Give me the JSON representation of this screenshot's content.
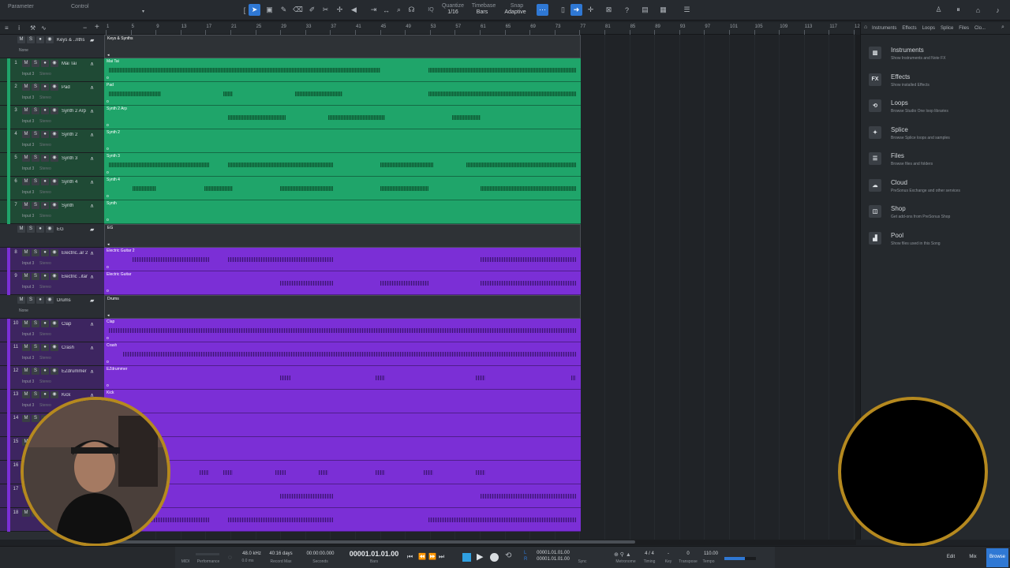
{
  "toolbar": {
    "parameter": "Parameter",
    "control": "Control",
    "quantize_label": "Quantize",
    "quantize_value": "1/16",
    "timebase_label": "Timebase",
    "timebase_value": "Bars",
    "snap_label": "Snap",
    "snap_value": "Adaptive",
    "iq": "IQ"
  },
  "ruler": {
    "ticks": [
      "1",
      "5",
      "9",
      "13",
      "17",
      "21",
      "25",
      "29",
      "33",
      "37",
      "41",
      "45",
      "49",
      "53",
      "57",
      "61",
      "65",
      "69",
      "73",
      "77",
      "81",
      "85",
      "89",
      "93",
      "97",
      "101",
      "105",
      "109",
      "113",
      "117",
      "121"
    ]
  },
  "tracks": [
    {
      "type": "folder",
      "name": "Keys & ..nths",
      "clip": "Keys & Synths",
      "input": "None"
    },
    {
      "num": "1",
      "name": "Mai Tai",
      "clip": "Mai Tai",
      "input": "Input 3",
      "mode": "Stereo",
      "color": "green"
    },
    {
      "num": "2",
      "name": "Pad",
      "clip": "Pad",
      "input": "Input 3",
      "mode": "Stereo",
      "color": "green"
    },
    {
      "num": "3",
      "name": "Synth 2 Arp",
      "clip": "Synth 2 Arp",
      "input": "Input 3",
      "mode": "Stereo",
      "color": "green"
    },
    {
      "num": "4",
      "name": "Synth 2",
      "clip": "Synth 2",
      "input": "Input 3",
      "mode": "Stereo",
      "color": "green"
    },
    {
      "num": "5",
      "name": "Synth 3",
      "clip": "Synth 3",
      "input": "Input 3",
      "mode": "Stereo",
      "color": "green"
    },
    {
      "num": "6",
      "name": "Synth 4",
      "clip": "Synth 4",
      "input": "Input 3",
      "mode": "Stereo",
      "color": "green"
    },
    {
      "num": "7",
      "name": "Synth",
      "clip": "Synth",
      "input": "Input 3",
      "mode": "Stereo",
      "color": "green"
    },
    {
      "type": "folder",
      "name": "EG",
      "clip": "EG",
      "input": ""
    },
    {
      "num": "8",
      "name": "Electric..ar 2",
      "clip": "Electric Guitar 2",
      "input": "Input 3",
      "mode": "Stereo",
      "color": "purple"
    },
    {
      "num": "9",
      "name": "Electric ..itar",
      "clip": "Electric Guitar",
      "input": "Input 3",
      "mode": "Stereo",
      "color": "purple"
    },
    {
      "type": "folder",
      "name": "Drums",
      "clip": "Drums",
      "input": "None"
    },
    {
      "num": "10",
      "name": "Clap",
      "clip": "Clap",
      "input": "Input 3",
      "mode": "Stereo",
      "color": "purple"
    },
    {
      "num": "11",
      "name": "Crash",
      "clip": "Crash",
      "input": "Input 3",
      "mode": "Stereo",
      "color": "purple"
    },
    {
      "num": "12",
      "name": "EZdrummer",
      "clip": "EZdrummer",
      "input": "Input 3",
      "mode": "Stereo",
      "color": "purple"
    },
    {
      "num": "13",
      "name": "Kick",
      "clip": "Kick",
      "input": "Input 3",
      "mode": "Stereo",
      "color": "purple"
    },
    {
      "num": "14",
      "name": "",
      "clip": "",
      "input": "",
      "mode": "",
      "color": "purple"
    },
    {
      "num": "15",
      "name": "",
      "clip": "",
      "input": "",
      "mode": "",
      "color": "purple"
    },
    {
      "num": "16",
      "name": "",
      "clip": "",
      "input": "",
      "mode": "",
      "color": "purple"
    },
    {
      "num": "17",
      "name": "",
      "clip": "",
      "input": "",
      "mode": "",
      "color": "purple"
    },
    {
      "num": "18",
      "name": "",
      "clip": "",
      "input": "",
      "mode": "",
      "color": "purple"
    }
  ],
  "browser": {
    "tabs": [
      "Instruments",
      "Effects",
      "Loops",
      "Splice",
      "Files",
      "Clo..."
    ],
    "items": [
      {
        "title": "Instruments",
        "desc": "Show Instruments and Note FX",
        "icon": "piano-icon"
      },
      {
        "title": "Effects",
        "desc": "Show installed Effects",
        "icon": "fx-icon"
      },
      {
        "title": "Loops",
        "desc": "Browse Studio One loop libraries",
        "icon": "loops-icon"
      },
      {
        "title": "Splice",
        "desc": "Browse Splice loops and samples",
        "icon": "splice-icon"
      },
      {
        "title": "Files",
        "desc": "Browse files and folders",
        "icon": "files-icon"
      },
      {
        "title": "Cloud",
        "desc": "PreSonus Exchange and other services",
        "icon": "cloud-icon"
      },
      {
        "title": "Shop",
        "desc": "Get add-ons from PreSonus Shop",
        "icon": "shop-icon"
      },
      {
        "title": "Pool",
        "desc": "Show files used in this Song",
        "icon": "pool-icon"
      }
    ]
  },
  "transport": {
    "midi": "MIDI",
    "performance": "Performance",
    "sample_rate": "48.0 kHz",
    "latency": "0.0 ms",
    "record_max_val": "40:16 days",
    "record_max": "Record Max",
    "seconds_val": "00:00:00.000",
    "seconds": "Seconds",
    "position": "00001.01.01.00",
    "bars": "Bars",
    "l_pos": "00001.01.01.00",
    "r_pos": "00001.01.01.00",
    "sync": "Sync",
    "metronome": "Metronome",
    "timing_val": "4 / 4",
    "timing": "Timing",
    "key_val": "-",
    "key": "Key",
    "transpose_val": "0",
    "transpose": "Transpose",
    "tempo_val": "110.00",
    "tempo": "Tempo",
    "edit": "Edit",
    "mix": "Mix",
    "browse": "Browse"
  },
  "colors": {
    "green": "#1fa56a",
    "purple": "#7b2fd6",
    "accent": "#2f78d4",
    "webcam_ring": "#b5891f"
  }
}
